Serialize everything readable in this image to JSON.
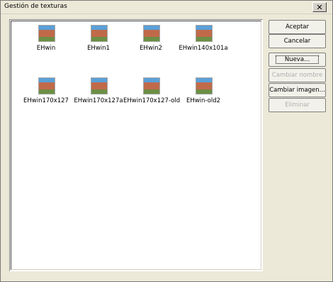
{
  "window": {
    "title": "Gestión de texturas"
  },
  "textures": [
    {
      "name": "EHwin"
    },
    {
      "name": "EHwin1"
    },
    {
      "name": "EHwin2"
    },
    {
      "name": "EHwin140x101a"
    },
    {
      "name": "EHwin170x127"
    },
    {
      "name": "EHwin170x127a"
    },
    {
      "name": "EHwin170x127-old"
    },
    {
      "name": "EHwin-old2"
    }
  ],
  "buttons": {
    "accept": "Aceptar",
    "cancel": "Cancelar",
    "new": "Nueva...",
    "rename": "Cambiar nombre",
    "change_image": "Cambiar imagen...",
    "delete": "Eliminar"
  }
}
